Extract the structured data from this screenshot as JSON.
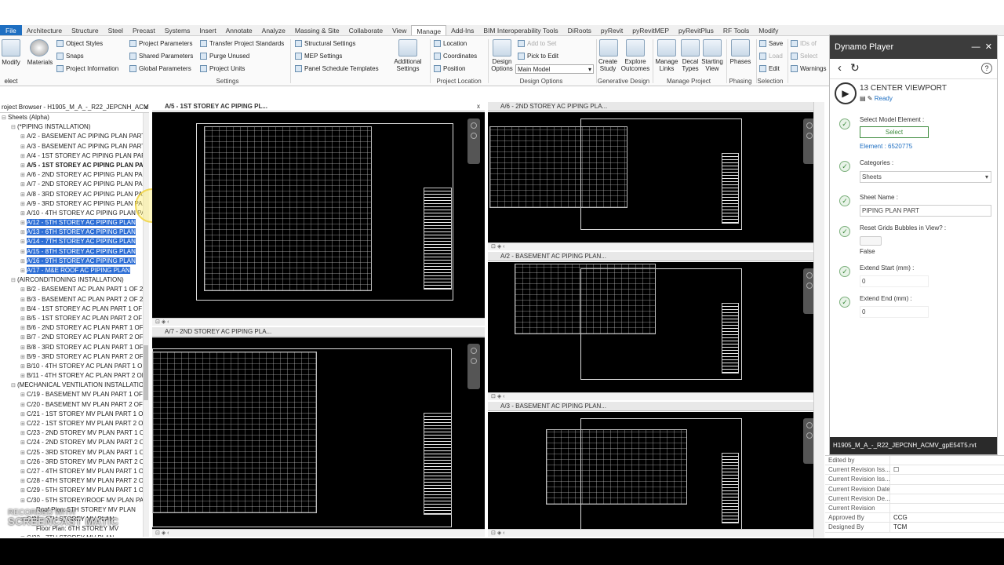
{
  "menu": {
    "tabs": [
      "File",
      "Architecture",
      "Structure",
      "Steel",
      "Precast",
      "Systems",
      "Insert",
      "Annotate",
      "Analyze",
      "Massing & Site",
      "Collaborate",
      "View",
      "Manage",
      "Add-Ins",
      "BIM Interoperability Tools",
      "DiRoots",
      "pyRevit",
      "pyRevitMEP",
      "pyRevitPlus",
      "RF Tools",
      "Modify"
    ],
    "active_index": 12
  },
  "ribbon": {
    "modify": "Modify",
    "select": "elect",
    "materials": "Materials",
    "object_styles": "Object Styles",
    "snaps": "Snaps",
    "project_information": "Project Information",
    "project_parameters": "Project Parameters",
    "shared_parameters": "Shared Parameters",
    "global_parameters": "Global Parameters",
    "transfer_standards": "Transfer Project Standards",
    "purge_unused": "Purge Unused",
    "project_units": "Project Units",
    "structural_settings": "Structural Settings",
    "mep_settings": "MEP Settings",
    "panel_schedule": "Panel Schedule Templates",
    "additional_settings": "Additional Settings",
    "location": "Location",
    "coordinates": "Coordinates",
    "position": "Position",
    "design_options": "Design Options",
    "add_to_set": "Add to Set",
    "pick_to_edit": "Pick to Edit",
    "main_model": "Main Model",
    "create_study": "Create Study",
    "explore_outcomes": "Explore Outcomes",
    "manage_links": "Manage Links",
    "decal_types": "Decal Types",
    "starting_view": "Starting View",
    "phases": "Phases",
    "save": "Save",
    "load": "Load",
    "edit": "Edit",
    "ids_of": "IDs of",
    "select_by": "Select",
    "warnings": "Warnings",
    "inquiry": "Inquiry",
    "panels": {
      "settings": "Settings",
      "project_location": "Project Location",
      "design_options": "Design Options",
      "generative_design": "Generative Design",
      "manage_project": "Manage Project",
      "phasing": "Phasing",
      "selection": "Selection"
    }
  },
  "project_browser": {
    "title": "roject Browser - H1905_M_A_-_R22_JEPCNH_ACMV...",
    "close": "x",
    "rows": [
      {
        "text": "Sheets (Alpha)",
        "level": 0,
        "exp": "⊟"
      },
      {
        "text": "(*PIPING INSTALLATION)",
        "level": 1,
        "exp": "⊟"
      },
      {
        "text": "A/2 - BASEMENT AC PIPING PLAN PART",
        "level": 2,
        "exp": "⊞"
      },
      {
        "text": "A/3 - BASEMENT AC PIPING PLAN PART",
        "level": 2,
        "exp": "⊞"
      },
      {
        "text": "A/4 - 1ST STOREY AC PIPING PLAN PAR",
        "level": 2,
        "exp": "⊞"
      },
      {
        "text": "A/5 - 1ST STOREY AC PIPING PLAN PA",
        "level": 2,
        "exp": "⊞",
        "bold": true
      },
      {
        "text": "A/6 - 2ND STOREY AC PIPING PLAN PAI",
        "level": 2,
        "exp": "⊞"
      },
      {
        "text": "A/7 - 2ND STOREY AC PIPING PLAN PA",
        "level": 2,
        "exp": "⊞"
      },
      {
        "text": "A/8 - 3RD STOREY AC PIPING PLAN PA",
        "level": 2,
        "exp": "⊞"
      },
      {
        "text": "A/9 - 3RD STOREY AC PIPING PLAN PAR",
        "level": 2,
        "exp": "⊞"
      },
      {
        "text": "A/10 - 4TH STOREY AC PIPING PLAN PA",
        "level": 2,
        "exp": "⊞"
      },
      {
        "text": "A/12 - 5TH STOREY AC PIPING PLAN",
        "level": 2,
        "exp": "⊞",
        "sel": true
      },
      {
        "text": "A/13 - 6TH STOREY AC PIPING PLAN",
        "level": 2,
        "exp": "⊞",
        "sel": true
      },
      {
        "text": "A/14 - 7TH STOREY AC PIPING PLAN",
        "level": 2,
        "exp": "⊞",
        "sel": true
      },
      {
        "text": "A/15 - 8TH STOREY AC PIPING PLAN",
        "level": 2,
        "exp": "⊞",
        "sel": true
      },
      {
        "text": "A/16 - 9TH STOREY AC PIPING PLAN",
        "level": 2,
        "exp": "⊞",
        "sel": true
      },
      {
        "text": "A/17 - M&E ROOF AC PIPING PLAN",
        "level": 2,
        "exp": "⊞",
        "sel": true
      },
      {
        "text": "(AIRCONDITIONING INSTALLATION)",
        "level": 1,
        "exp": "⊟"
      },
      {
        "text": "B/2 - BASEMENT AC PLAN PART 1 OF 2",
        "level": 2,
        "exp": "⊞"
      },
      {
        "text": "B/3 - BASEMENT AC PLAN PART 2 OF 2",
        "level": 2,
        "exp": "⊞"
      },
      {
        "text": "B/4 - 1ST STOREY AC PLAN PART 1 OF",
        "level": 2,
        "exp": "⊞"
      },
      {
        "text": "B/5 - 1ST STOREY AC PLAN PART 2 OF",
        "level": 2,
        "exp": "⊞"
      },
      {
        "text": "B/6 - 2ND STOREY AC PLAN PART 1 OF",
        "level": 2,
        "exp": "⊞"
      },
      {
        "text": "B/7 - 2ND STOREY AC PLAN PART 2 OF",
        "level": 2,
        "exp": "⊞"
      },
      {
        "text": "B/8 - 3RD STOREY AC PLAN PART 1 OF",
        "level": 2,
        "exp": "⊞"
      },
      {
        "text": "B/9 - 3RD STOREY AC PLAN PART 2 OF",
        "level": 2,
        "exp": "⊞"
      },
      {
        "text": "B/10 - 4TH STOREY AC PLAN PART 1 OF",
        "level": 2,
        "exp": "⊞"
      },
      {
        "text": "B/11 - 4TH STOREY AC PLAN PART 2 OF",
        "level": 2,
        "exp": "⊞"
      },
      {
        "text": "(MECHANICAL VENTILATION INSTALLATION",
        "level": 1,
        "exp": "⊟"
      },
      {
        "text": "C/19 - BASEMENT MV PLAN PART 1 OF",
        "level": 2,
        "exp": "⊞"
      },
      {
        "text": "C/20 - BASEMENT MV PLAN PART 2 OF",
        "level": 2,
        "exp": "⊞"
      },
      {
        "text": "C/21 - 1ST STOREY MV PLAN PART 1 OF",
        "level": 2,
        "exp": "⊞"
      },
      {
        "text": "C/22 - 1ST STOREY MV PLAN PART 2 OF",
        "level": 2,
        "exp": "⊞"
      },
      {
        "text": "C/23 - 2ND STOREY MV PLAN PART 1 O",
        "level": 2,
        "exp": "⊞"
      },
      {
        "text": "C/24 - 2ND STOREY MV PLAN PART 2 O",
        "level": 2,
        "exp": "⊞"
      },
      {
        "text": "C/25 - 3RD STOREY MV PLAN PART 1 OF",
        "level": 2,
        "exp": "⊞"
      },
      {
        "text": "C/26 - 3RD STOREY MV PLAN PART 2 OI",
        "level": 2,
        "exp": "⊞"
      },
      {
        "text": "C/27 - 4TH STOREY MV PLAN PART 1 OI",
        "level": 2,
        "exp": "⊞"
      },
      {
        "text": "C/28 - 4TH STOREY MV PLAN PART 2 OI",
        "level": 2,
        "exp": "⊞"
      },
      {
        "text": "C/29 - 5TH STOREY MV PLAN PART 1 OI",
        "level": 2,
        "exp": "⊞"
      },
      {
        "text": "C/30 - 5TH STOREY/ROOF MV PLAN PA",
        "level": 2,
        "exp": "⊞"
      },
      {
        "text": "Roof Plan: 5TH STOREY MV PLAN",
        "level": 3,
        "exp": ""
      },
      {
        "text": "C/31 - 6TH STOREY MV PLAN",
        "level": 2,
        "exp": "⊞"
      },
      {
        "text": "Floor Plan: 6TH STOREY MV",
        "level": 3,
        "exp": ""
      },
      {
        "text": "C/32 - 7TH STOREY MV PLAN",
        "level": 2,
        "exp": "⊞"
      }
    ]
  },
  "views": [
    {
      "title": "A/5 - 1ST STOREY AC PIPING PL...",
      "close": "x",
      "active": true
    },
    {
      "title": "A/6 - 2ND STOREY AC PIPING PLA...",
      "close": "",
      "active": false
    },
    {
      "title": "A/7 - 2ND STOREY AC PIPING PLA...",
      "close": "",
      "active": false
    },
    {
      "title": "A/2 - BASEMENT AC PIPING PLAN...",
      "close": "",
      "active": false
    },
    {
      "title": "A/3 - BASEMENT AC PIPING PLAN...",
      "close": "",
      "active": false
    }
  ],
  "dynamo": {
    "title": "Dynamo Player",
    "minimize": "—",
    "close": "✕",
    "script_name": "13 CENTER VIEWPORT",
    "status": "Ready",
    "select_model_element_label": "Select Model Element :",
    "select_button": "Select",
    "element": "Element : 6520775",
    "categories_label": "Categories :",
    "categories_value": "Sheets",
    "sheet_name_label": "Sheet Name :",
    "sheet_name_value": "PIPING PLAN PART",
    "reset_grids_label": "Reset Grids Bubbles in View? :",
    "reset_grids_value": "False",
    "extend_start_label": "Extend Start (mm) :",
    "extend_start_value": "0",
    "extend_end_label": "Extend End (mm) :",
    "extend_end_value": "0",
    "footer": "H1905_M_A_-_R22_JEPCNH_ACMV_gpE54T5.rvt"
  },
  "properties": {
    "rows": [
      {
        "k": "Edited by",
        "v": ""
      },
      {
        "k": "Current Revision Iss...",
        "v": "☐"
      },
      {
        "k": "Current Revision Iss...",
        "v": ""
      },
      {
        "k": "Current Revision Date",
        "v": ""
      },
      {
        "k": "Current Revision De...",
        "v": ""
      },
      {
        "k": "Current Revision",
        "v": ""
      },
      {
        "k": "Approved By",
        "v": "CCG"
      },
      {
        "k": "Designed By",
        "v": "TCM"
      }
    ]
  },
  "watermark": {
    "line1": "RECORDED WITH",
    "line2": "SCREENCAST",
    "line3": "MATIC"
  },
  "colors": {
    "accent": "#1e6fc2",
    "selection": "#2e6fd6",
    "dynamo_header": "#3c3c3c",
    "ok": "#3b8a3b"
  }
}
